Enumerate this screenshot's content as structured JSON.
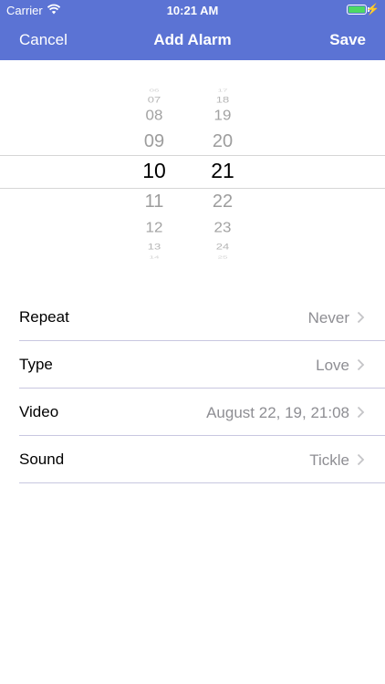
{
  "status_bar": {
    "carrier": "Carrier",
    "time": "10:21 AM",
    "battery_color": "#4cd964"
  },
  "nav": {
    "cancel_label": "Cancel",
    "title": "Add Alarm",
    "save_label": "Save",
    "background": "#5b73d4"
  },
  "picker": {
    "hours": [
      "06",
      "07",
      "08",
      "09",
      "10",
      "11",
      "12",
      "13",
      "14"
    ],
    "minutes": [
      "17",
      "18",
      "19",
      "20",
      "21",
      "22",
      "23",
      "24",
      "25"
    ],
    "selected_hour": "10",
    "selected_minute": "21"
  },
  "settings": {
    "repeat": {
      "label": "Repeat",
      "value": "Never"
    },
    "type": {
      "label": "Type",
      "value": "Love"
    },
    "video": {
      "label": "Video",
      "value": "August 22, 19, 21:08"
    },
    "sound": {
      "label": "Sound",
      "value": "Tickle"
    }
  },
  "icons": [
    "wifi-icon",
    "battery-icon",
    "charging-bolt-icon",
    "chevron-right-icon"
  ]
}
